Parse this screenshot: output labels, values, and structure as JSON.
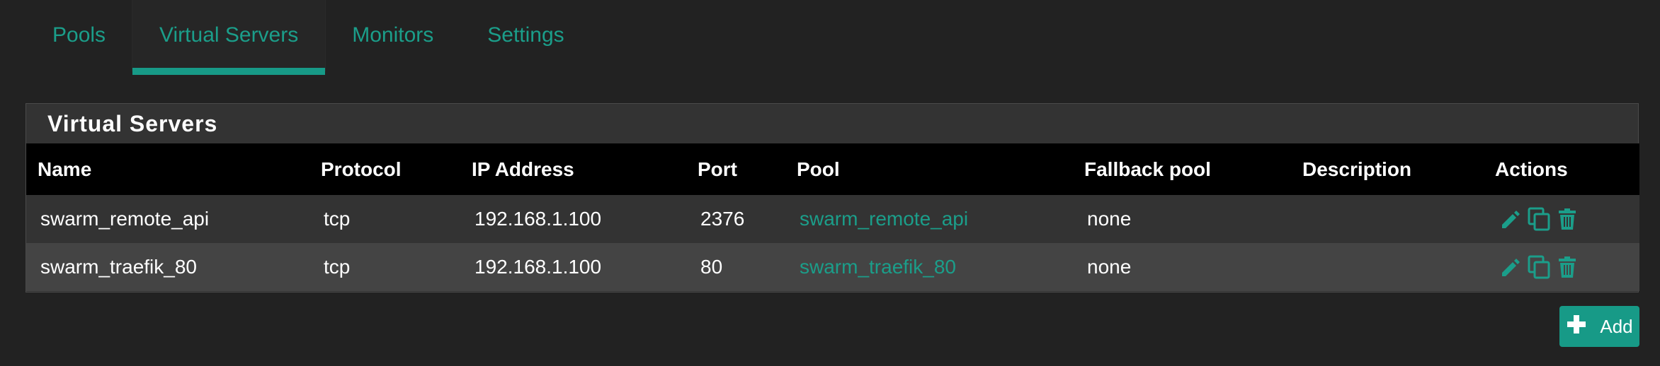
{
  "tabs": [
    {
      "label": "Pools",
      "active": false
    },
    {
      "label": "Virtual Servers",
      "active": true
    },
    {
      "label": "Monitors",
      "active": false
    },
    {
      "label": "Settings",
      "active": false
    }
  ],
  "panel": {
    "title": "Virtual Servers"
  },
  "table": {
    "headers": {
      "name": "Name",
      "protocol": "Protocol",
      "ip": "IP Address",
      "port": "Port",
      "pool": "Pool",
      "fallback": "Fallback pool",
      "description": "Description",
      "actions": "Actions"
    },
    "rows": [
      {
        "name": "swarm_remote_api",
        "protocol": "tcp",
        "ip": "192.168.1.100",
        "port": "2376",
        "pool": "swarm_remote_api",
        "fallback": "none",
        "description": ""
      },
      {
        "name": "swarm_traefik_80",
        "protocol": "tcp",
        "ip": "192.168.1.100",
        "port": "80",
        "pool": "swarm_traefik_80",
        "fallback": "none",
        "description": ""
      }
    ],
    "action_icons": [
      "edit-icon",
      "copy-icon",
      "delete-icon"
    ]
  },
  "add_button": {
    "label": "Add",
    "icon": "plus-icon"
  },
  "colors": {
    "accent": "#179a87",
    "background": "#222222",
    "header": "#000000"
  }
}
